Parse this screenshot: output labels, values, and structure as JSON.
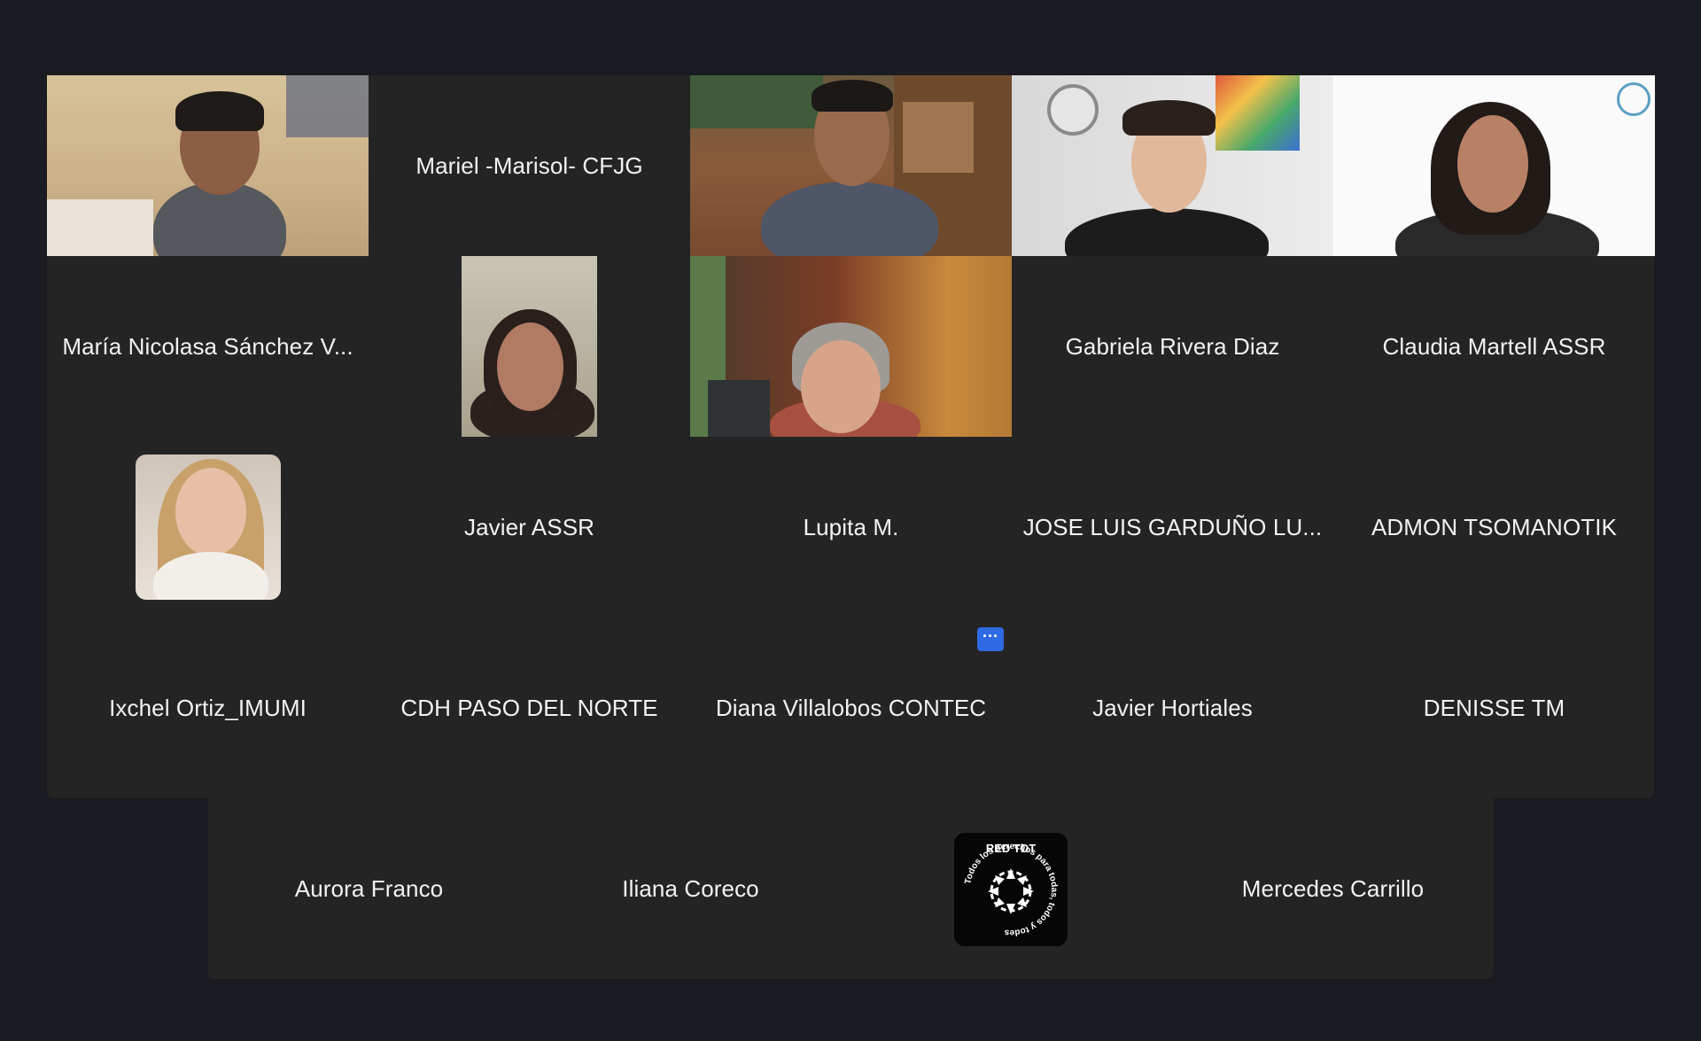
{
  "participants": [
    {
      "name": "Mariel -Marisol- CFJG"
    },
    {
      "name": "María Nicolasa Sánchez V..."
    },
    {
      "name": "Gabriela Rivera Diaz"
    },
    {
      "name": "Claudia Martell ASSR"
    },
    {
      "name": "Javier ASSR"
    },
    {
      "name": "Lupita M."
    },
    {
      "name": "JOSE LUIS GARDUÑO LU..."
    },
    {
      "name": "ADMON TSOMANOTIK"
    },
    {
      "name": "Ixchel Ortiz_IMUMI"
    },
    {
      "name": "CDH PASO DEL NORTE"
    },
    {
      "name": "Diana Villalobos CONTEC"
    },
    {
      "name": "Javier Hortiales"
    },
    {
      "name": "DENISSE TM"
    },
    {
      "name": "Aurora Franco"
    },
    {
      "name": "Iliana Coreco"
    },
    {
      "name": "Mercedes Carrillo"
    }
  ],
  "more_button": {
    "label": "···"
  },
  "logo": {
    "text": "RED TDT",
    "ring_text": "Todos los derechos para todas, todos y todes"
  },
  "colors": {
    "active_speaker": "#23d959",
    "tile_bg": "#242424",
    "page_bg": "#1a1c21",
    "more_button": "#2d6ae3"
  }
}
